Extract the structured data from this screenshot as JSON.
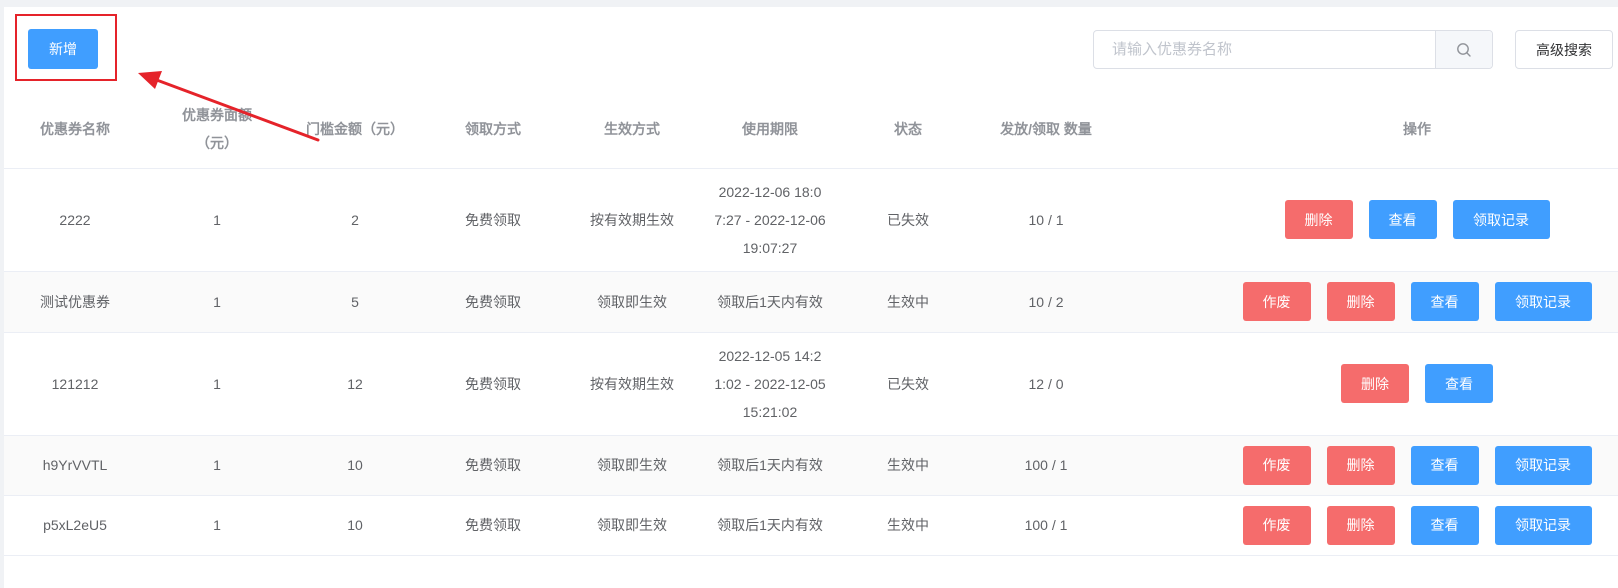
{
  "toolbar": {
    "add_label": "新增",
    "search_placeholder": "请输入优惠券名称",
    "search_value": "",
    "advanced_label": "高级搜索"
  },
  "table": {
    "columns": [
      "优惠券名称",
      "优惠券面额（元）",
      "门槛金额（元）",
      "领取方式",
      "生效方式",
      "使用期限",
      "状态",
      "发放/领取 数量",
      "操作"
    ],
    "rows": [
      {
        "name": "2222",
        "face": "1",
        "threshold": "2",
        "receive": "免费领取",
        "effect": "按有效期生效",
        "period": "2022-12-06 18:07:27 - 2022-12-06 19:07:27",
        "status": "已失效",
        "count": "10 / 1",
        "actions": [
          "删除",
          "查看",
          "领取记录"
        ]
      },
      {
        "name": "测试优惠券",
        "face": "1",
        "threshold": "5",
        "receive": "免费领取",
        "effect": "领取即生效",
        "period": "领取后1天内有效",
        "status": "生效中",
        "count": "10 / 2",
        "actions": [
          "作废",
          "删除",
          "查看",
          "领取记录"
        ]
      },
      {
        "name": "121212",
        "face": "1",
        "threshold": "12",
        "receive": "免费领取",
        "effect": "按有效期生效",
        "period": "2022-12-05 14:21:02 - 2022-12-05 15:21:02",
        "status": "已失效",
        "count": "12 / 0",
        "actions": [
          "删除",
          "查看"
        ]
      },
      {
        "name": "h9YrVVTL",
        "face": "1",
        "threshold": "10",
        "receive": "免费领取",
        "effect": "领取即生效",
        "period": "领取后1天内有效",
        "status": "生效中",
        "count": "100 / 1",
        "actions": [
          "作废",
          "删除",
          "查看",
          "领取记录"
        ]
      },
      {
        "name": "p5xL2eU5",
        "face": "1",
        "threshold": "10",
        "receive": "免费领取",
        "effect": "领取即生效",
        "period": "领取后1天内有效",
        "status": "生效中",
        "count": "100 / 1",
        "actions": [
          "作废",
          "删除",
          "查看",
          "领取记录"
        ]
      }
    ]
  },
  "colors": {
    "primary": "#409eff",
    "danger": "#f56c6c",
    "annotation": "#e5232a"
  }
}
